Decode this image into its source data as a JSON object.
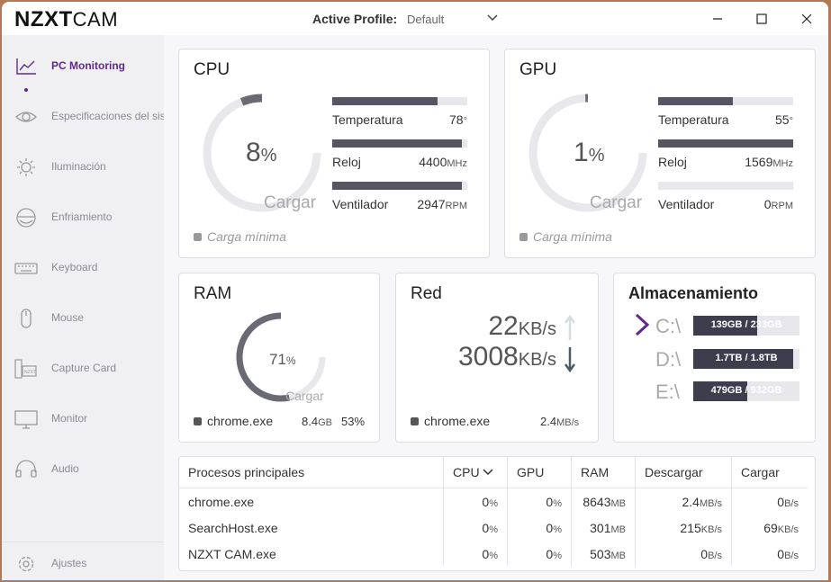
{
  "app": {
    "brand_bold": "NZXT",
    "brand_light": "CAM"
  },
  "profile": {
    "label": "Active Profile:",
    "value": "Default"
  },
  "sidebar": {
    "items": [
      {
        "label": "PC Monitoring"
      },
      {
        "label": "Especificaciones del sistema"
      },
      {
        "label": "Iluminación"
      },
      {
        "label": "Enfriamiento"
      },
      {
        "label": "Keyboard"
      },
      {
        "label": "Mouse"
      },
      {
        "label": "Capture Card"
      },
      {
        "label": "Monitor"
      },
      {
        "label": "Audio"
      }
    ],
    "settings_label": "Ajustes"
  },
  "cpu": {
    "title": "CPU",
    "load_value": "8",
    "load_unit": "%",
    "load_fraction": 0.08,
    "load_label": "Cargar",
    "min_load": "Carga mínima",
    "temp_label": "Temperatura",
    "temp_value": "78",
    "temp_unit": "°",
    "temp_fraction": 0.78,
    "clock_label": "Reloj",
    "clock_value": "4400",
    "clock_unit": "MHz",
    "clock_fraction": 0.96,
    "fan_label": "Ventilador",
    "fan_value": "2947",
    "fan_unit": "RPM",
    "fan_fraction": 0.96
  },
  "gpu": {
    "title": "GPU",
    "load_value": "1",
    "load_unit": "%",
    "load_fraction": 0.01,
    "load_label": "Cargar",
    "min_load": "Carga mínima",
    "temp_label": "Temperatura",
    "temp_value": "55",
    "temp_unit": "°",
    "temp_fraction": 0.55,
    "clock_label": "Reloj",
    "clock_value": "1569",
    "clock_unit": "MHz",
    "clock_fraction": 1.0,
    "fan_label": "Ventilador",
    "fan_value": "0",
    "fan_unit": "RPM",
    "fan_fraction": 0.0
  },
  "ram": {
    "title": "RAM",
    "load_value": "71",
    "load_unit": "%",
    "load_fraction": 0.71,
    "load_label": "Cargar",
    "proc_name": "chrome.exe",
    "proc_mem": "8.4",
    "proc_mem_unit": "GB",
    "proc_pct": "53%"
  },
  "network": {
    "title": "Red",
    "up_value": "22",
    "up_unit": "KB/s",
    "down_value": "3008",
    "down_unit": "KB/s",
    "proc_name": "chrome.exe",
    "proc_rate": "2.4",
    "proc_rate_unit": "MB/s"
  },
  "storage": {
    "title": "Almacenamiento",
    "drives": [
      {
        "label": "C:\\",
        "text": "139GB / 233GB",
        "fraction": 0.6
      },
      {
        "label": "D:\\",
        "text": "1.7TB / 1.8TB",
        "fraction": 0.94
      },
      {
        "label": "E:\\",
        "text": "479GB / 932GB",
        "fraction": 0.51
      }
    ]
  },
  "processes": {
    "headers": [
      "Procesos principales",
      "CPU",
      "GPU",
      "RAM",
      "Descargar",
      "Cargar"
    ],
    "rows": [
      {
        "name": "chrome.exe",
        "cpu": "0",
        "gpu": "0",
        "ram": "8643",
        "down": "2.4",
        "down_unit": "MB/s",
        "up": "0",
        "up_unit": "B/s"
      },
      {
        "name": "SearchHost.exe",
        "cpu": "0",
        "gpu": "0",
        "ram": "301",
        "down": "215",
        "down_unit": "KB/s",
        "up": "69",
        "up_unit": "KB/s"
      },
      {
        "name": "NZXT CAM.exe",
        "cpu": "0",
        "gpu": "0",
        "ram": "503",
        "down": "0",
        "down_unit": "B/s",
        "up": "0",
        "up_unit": "B/s"
      }
    ],
    "pct": "%",
    "mb": "MB"
  },
  "colors": {
    "accent": "#5e2a8a",
    "bar": "#565663",
    "track": "#e8e8ec"
  }
}
